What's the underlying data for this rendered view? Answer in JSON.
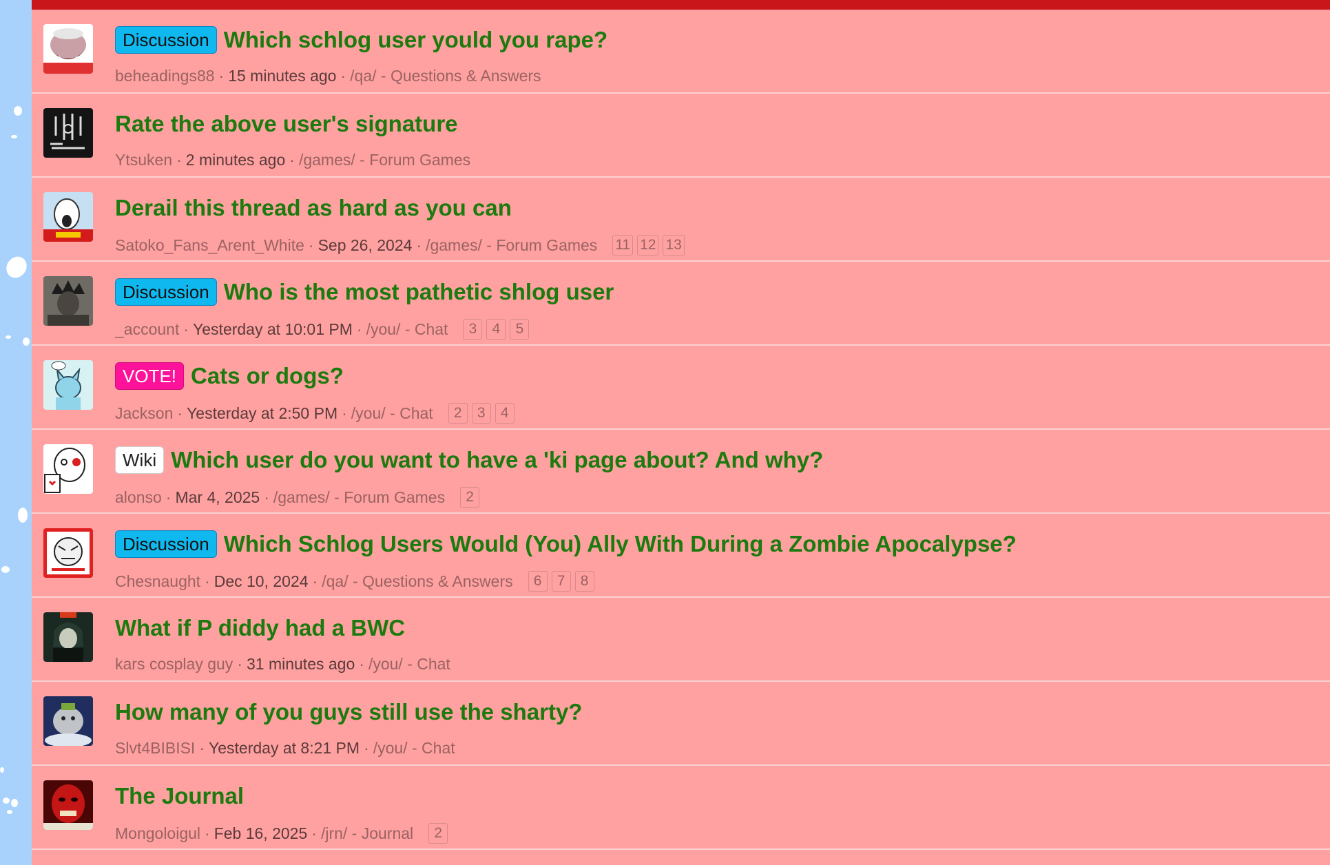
{
  "colors": {
    "page_bg": "#a8d2fb",
    "panel_bg": "#ffa1a1",
    "top_bar": "#c8161b",
    "title_green": "#1c7a0e",
    "badge_discussion": "#10b8f0",
    "badge_vote": "#ff129a",
    "badge_wiki": "#ffffff"
  },
  "threads": [
    {
      "badge": "Discussion",
      "badge_type": "discussion",
      "title": "Which schlog user yould you rape?",
      "author": "beheadings88",
      "date": "15 minutes ago",
      "forum": "/qa/ - Questions & Answers",
      "pages": [],
      "avatar_icon": "cartoon-boar-avatar-icon"
    },
    {
      "badge": "",
      "badge_type": "",
      "title": "Rate the above user's signature",
      "author": "Ytsuken",
      "date": "2 minutes ago",
      "forum": "/games/ - Forum Games",
      "pages": [],
      "avatar_icon": "line-drawing-avatar-icon"
    },
    {
      "badge": "",
      "badge_type": "",
      "title": "Derail this thread as hard as you can",
      "author": "Satoko_Fans_Arent_White",
      "date": "Sep 26, 2024",
      "forum": "/games/ - Forum Games",
      "pages": [
        "11",
        "12",
        "13"
      ],
      "avatar_icon": "screaming-wojak-avatar-icon"
    },
    {
      "badge": "Discussion",
      "badge_type": "discussion",
      "title": "Who is the most pathetic shlog user",
      "author": "_account",
      "date": "Yesterday at 10:01 PM",
      "forum": "/you/ - Chat",
      "pages": [
        "3",
        "4",
        "5"
      ],
      "avatar_icon": "dark-portrait-avatar-icon"
    },
    {
      "badge": "VOTE!",
      "badge_type": "vote",
      "title": "Cats or dogs?",
      "author": "Jackson",
      "date": "Yesterday at 2:50 PM",
      "forum": "/you/ - Chat",
      "pages": [
        "2",
        "3",
        "4"
      ],
      "avatar_icon": "blue-cat-avatar-icon"
    },
    {
      "badge": "Wiki",
      "badge_type": "wiki",
      "title": "Which user do you want to have a 'ki page about? And why?",
      "author": "alonso",
      "date": "Mar 4, 2025",
      "forum": "/games/ - Forum Games",
      "pages": [
        "2"
      ],
      "avatar_icon": "wojak-coffee-avatar-icon"
    },
    {
      "badge": "Discussion",
      "badge_type": "discussion",
      "title": "Which Schlog Users Would (You) Ally With During a Zombie Apocalypse?",
      "author": "Chesnaught",
      "date": "Dec 10, 2024",
      "forum": "/qa/ - Questions & Answers",
      "pages": [
        "6",
        "7",
        "8"
      ],
      "avatar_icon": "red-framed-sketch-avatar-icon"
    },
    {
      "badge": "",
      "badge_type": "",
      "title": "What if P diddy had a BWC",
      "author": "kars cosplay guy",
      "date": "31 minutes ago",
      "forum": "/you/ - Chat",
      "pages": [],
      "avatar_icon": "anime-character-avatar-icon"
    },
    {
      "badge": "",
      "badge_type": "",
      "title": "How many of you guys still use the sharty?",
      "author": "Slvt4BIBISI",
      "date": "Yesterday at 8:21 PM",
      "forum": "/you/ - Chat",
      "pages": [],
      "avatar_icon": "plush-figure-avatar-icon"
    },
    {
      "badge": "",
      "badge_type": "",
      "title": "The Journal",
      "author": "Mongoloigul",
      "date": "Feb 16, 2025",
      "forum": "/jrn/ - Journal",
      "pages": [
        "2"
      ],
      "avatar_icon": "red-face-avatar-icon"
    }
  ]
}
